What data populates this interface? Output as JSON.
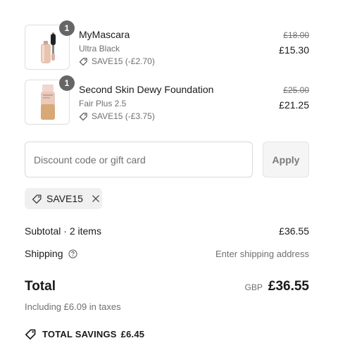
{
  "items": [
    {
      "quantity": "1",
      "name": "MyMascara",
      "variant": "Ultra Black",
      "discount": "SAVE15 (-£2.70)",
      "original_price": "£18.00",
      "price": "£15.30"
    },
    {
      "quantity": "1",
      "name": "Second Skin Dewy Foundation",
      "variant": "Fair Plus 2.5",
      "discount": "SAVE15 (-£3.75)",
      "original_price": "£25.00",
      "price": "£21.25"
    }
  ],
  "discount_form": {
    "placeholder": "Discount code or gift card",
    "value": "",
    "apply_label": "Apply"
  },
  "applied_code": {
    "code": "SAVE15"
  },
  "summary": {
    "subtotal_label": "Subtotal · 2 items",
    "subtotal_value": "£36.55",
    "shipping_label": "Shipping",
    "shipping_value": "Enter shipping address",
    "total_label": "Total",
    "currency": "GBP",
    "total_value": "£36.55",
    "taxes_note": "Including £6.09 in taxes",
    "savings_label": "TOTAL SAVINGS",
    "savings_value": "£6.45"
  },
  "icons": {
    "tag": "tag-icon",
    "close": "close-icon",
    "help": "help-circle-icon"
  },
  "colors": {
    "qty_badge": "#666666",
    "muted_text": "#707070",
    "chip_bg": "#f0f0f0"
  }
}
